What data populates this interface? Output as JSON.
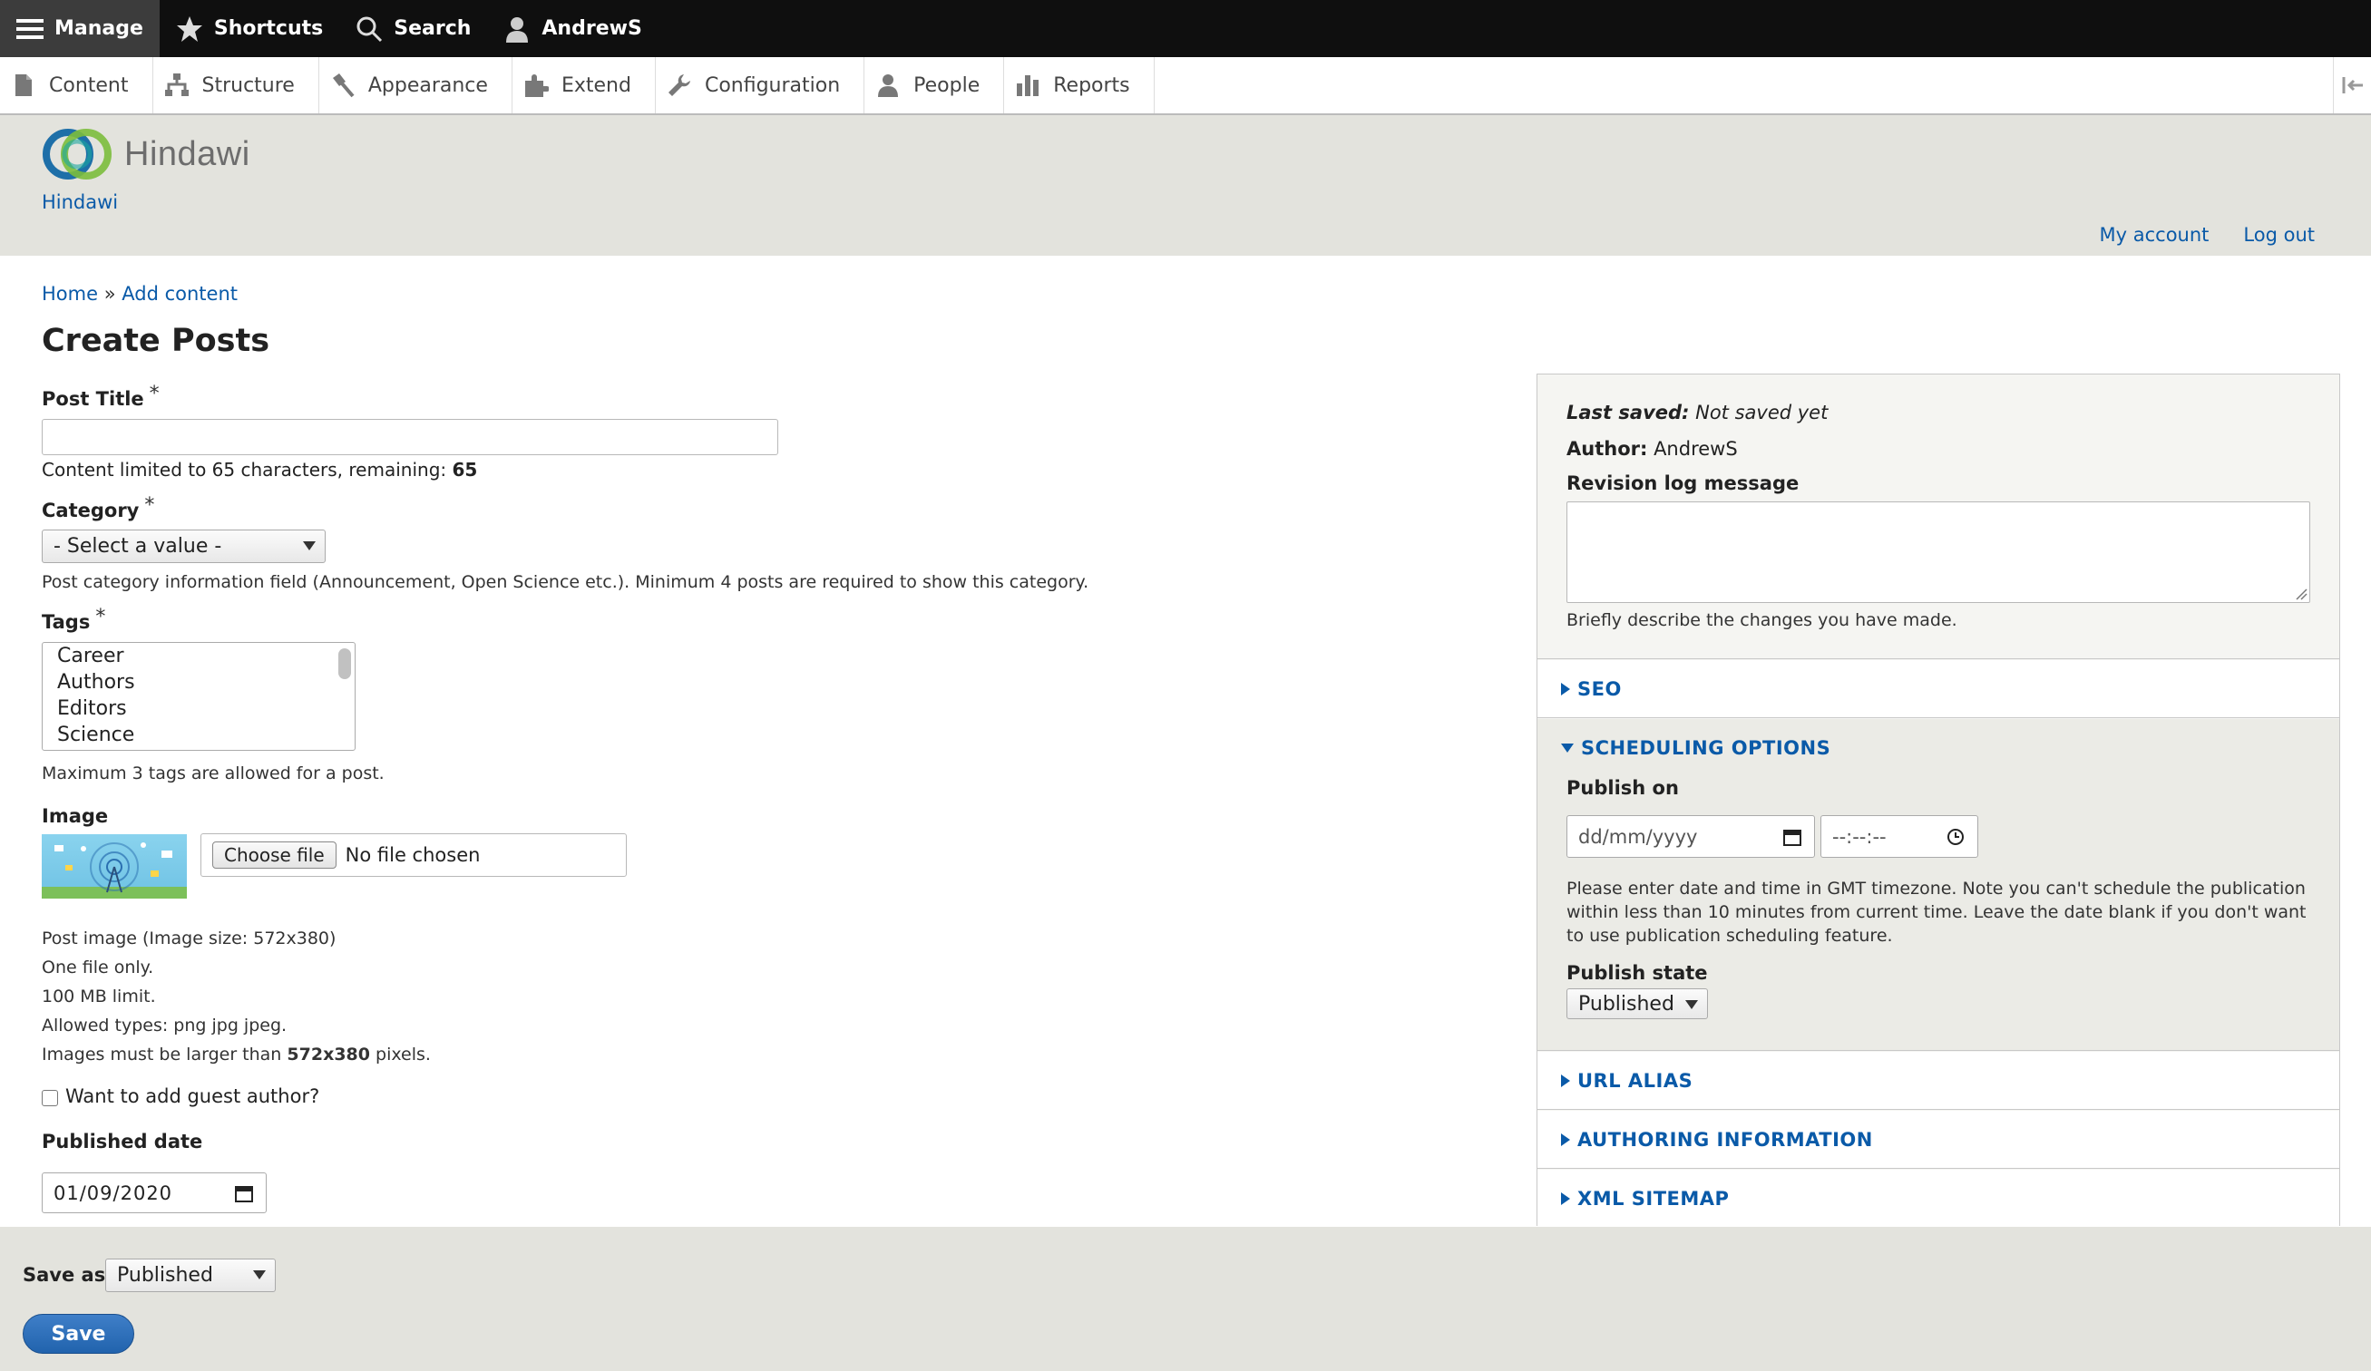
{
  "toolbar": {
    "manage": "Manage",
    "shortcuts": "Shortcuts",
    "search": "Search",
    "user": "AndrewS"
  },
  "tray": {
    "items": [
      "Content",
      "Structure",
      "Appearance",
      "Extend",
      "Configuration",
      "People",
      "Reports"
    ]
  },
  "header": {
    "logo_text": "Hindawi",
    "site_name": "Hindawi",
    "my_account": "My account",
    "log_out": "Log out"
  },
  "breadcrumb": {
    "home": "Home",
    "sep": "»",
    "add_content": "Add content"
  },
  "page": {
    "title": "Create Posts"
  },
  "form": {
    "post_title_label": "Post Title",
    "required_mark": "*",
    "post_title_value": "",
    "char_limit_text": "Content limited to 65 characters, remaining:",
    "char_remaining": "65",
    "category_label": "Category",
    "category_value": "- Select a value -",
    "category_desc": "Post category information field (Announcement, Open Science etc.). Minimum 4 posts are required to show this category.",
    "tags_label": "Tags",
    "tags_options": [
      "Career",
      "Authors",
      "Editors",
      "Science"
    ],
    "tags_desc": "Maximum 3 tags are allowed for a post.",
    "image_label": "Image",
    "choose_file": "Choose file",
    "no_file": "No file chosen",
    "image_desc": {
      "line1": "Post image (Image size: 572x380)",
      "line2": "One file only.",
      "line3": "100 MB limit.",
      "line4": "Allowed types: png jpg jpeg.",
      "line5_pre": "Images must be larger than",
      "line5_bold": "572x380",
      "line5_post": "pixels."
    },
    "guest_author_label": "Want to add guest author?",
    "published_date_label": "Published date",
    "published_date_value": "01/09/2020"
  },
  "sidebar": {
    "last_saved_label": "Last saved:",
    "last_saved_value": "Not saved yet",
    "author_label": "Author:",
    "author_value": "AndrewS",
    "revision_label": "Revision log message",
    "revision_desc": "Briefly describe the changes you have made.",
    "seo": "SEO",
    "scheduling": "SCHEDULING OPTIONS",
    "publish_on_label": "Publish on",
    "publish_date_placeholder": "dd/mm/yyyy",
    "publish_time_placeholder": "--:--:--",
    "schedule_desc": "Please enter date and time in GMT timezone. Note you can't schedule the publication within less than 10 minutes from current time. Leave the date blank if you don't want to use publication scheduling feature.",
    "publish_state_label": "Publish state",
    "publish_state_value": "Published",
    "url_alias": "URL ALIAS",
    "authoring": "AUTHORING INFORMATION",
    "xml_sitemap": "XML SITEMAP"
  },
  "footer": {
    "save_as_label": "Save as:",
    "save_as_value": "Published",
    "save_button": "Save"
  },
  "colors": {
    "toolbar_bg": "#0f0f0f",
    "link": "#0a5aa8",
    "header_bg": "#e3e3dd",
    "save_button": "#2b6cb5"
  }
}
